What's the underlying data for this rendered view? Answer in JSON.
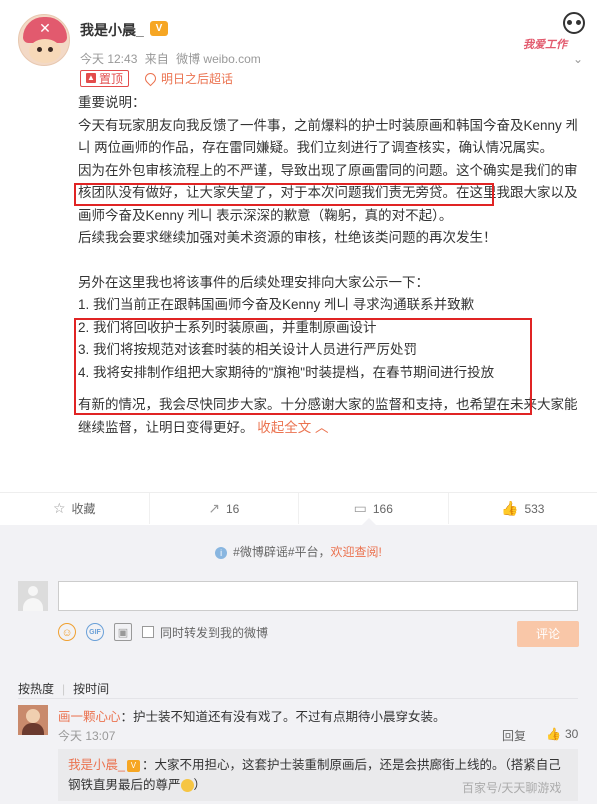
{
  "post": {
    "username": "我是小晨_",
    "vip_badge": "V",
    "stamp_text": "我爱工作",
    "dropdown_icon": "chevron-down-icon",
    "time": "今天 12:43",
    "source_prefix": "来自",
    "source": "微博 weibo.com",
    "pin_label": "置顶",
    "super_topic": "明日之后超话",
    "paragraphs": [
      "重要说明：",
      "今天有玩家朋友向我反馈了一件事，之前爆料的护士时装原画和韩国今奋及Kenny 케니 两位画师的作品，存在雷同嫌疑。我们立刻进行了调查核实，确认情况属实。"
    ],
    "highlight_sentence": "因为在外包审核流程上的不严谨，导致出现了原画雷同的问题。",
    "paragraph_continue": "这个确实是我们的审核团队没有做好，让大家失望了，对于本次问题我们责无旁贷。在这里我跟大家以及画师今奋及Kenny 케니 表示深深的歉意（鞠躬，真的对不起）。",
    "paragraph_followup": "后续我会要求继续加强对美术资源的审核，杜绝该类问题的再次发生！",
    "list_intro": "另外在这里我也将该事件的后续处理安排向大家公示一下：",
    "list_items": [
      "1. 我们当前正在跟韩国画师今奋及Kenny 케니 寻求沟通联系并致歉",
      "2. 我们将回收护士系列时装原画，并重制原画设计",
      "3. 我们将按规范对该套时装的相关设计人员进行严厉处罚",
      "4. 我将安排制作组把大家期待的\"旗袍\"时装提档，在春节期间进行投放"
    ],
    "closing": "有新的情况，我会尽快同步大家。十分感谢大家的监督和支持，也希望在未来大家能继续监督，让明日变得更好。",
    "collapse_label": "收起全文 ︿"
  },
  "actions": {
    "favorite": {
      "icon": "star-icon",
      "label": "收藏"
    },
    "forward": {
      "icon": "forward-icon",
      "label": "16"
    },
    "comment": {
      "icon": "comment-icon",
      "label": "166"
    },
    "like": {
      "icon": "thumbs-up-icon",
      "label": "533"
    }
  },
  "comments": {
    "notice_prefix": "#微博辟谣#平台，",
    "notice_link": "欢迎查阅!",
    "input_placeholder": "",
    "forward_checkbox_label": "同时转发到我的微博",
    "submit_label": "评论",
    "sort_hot": "按热度",
    "sort_time": "按时间",
    "items": [
      {
        "user": "画一颗心心",
        "text": "：护士装不知道还有没有戏了。不过有点期待小晨穿女装。",
        "time": "今天 13:07",
        "reply_label": "回复",
        "likes": "30"
      }
    ],
    "sub_reply": {
      "user": "我是小晨_",
      "vip": "V",
      "text": "：大家不用担心，这套护士装重制原画后，还是会拱廊街上线的。（搭紧自己钢铁直男最后的尊严",
      "suffix": "）"
    }
  },
  "watermark": "百家号/天天聊游戏",
  "colors": {
    "accent": "#eb7350",
    "highlight_box": "#e02424",
    "comment_bg": "#f2f2f5"
  }
}
